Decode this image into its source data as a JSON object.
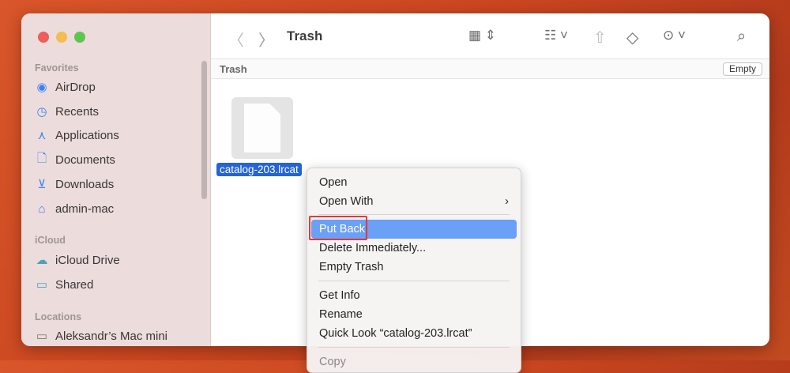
{
  "window": {
    "title": "Trash"
  },
  "sidebar": {
    "sections": [
      {
        "label": "Favorites",
        "items": [
          {
            "label": "AirDrop",
            "icon": "airdrop-icon"
          },
          {
            "label": "Recents",
            "icon": "clock-icon"
          },
          {
            "label": "Applications",
            "icon": "applications-icon"
          },
          {
            "label": "Documents",
            "icon": "document-icon"
          },
          {
            "label": "Downloads",
            "icon": "download-icon"
          },
          {
            "label": "admin-mac",
            "icon": "home-icon"
          }
        ]
      },
      {
        "label": "iCloud",
        "items": [
          {
            "label": "iCloud Drive",
            "icon": "cloud-icon"
          },
          {
            "label": "Shared",
            "icon": "shared-folder-icon"
          }
        ]
      },
      {
        "label": "Locations",
        "items": [
          {
            "label": "Aleksandr’s Mac mini",
            "icon": "computer-icon"
          }
        ]
      }
    ]
  },
  "pathbar": {
    "label": "Trash",
    "empty_button": "Empty"
  },
  "file": {
    "name": "catalog-203.lrcat"
  },
  "context_menu": {
    "items": [
      "Open",
      "Open With",
      "Put Back",
      "Delete Immediately...",
      "Empty Trash",
      "Get Info",
      "Rename",
      "Quick Look “catalog-203.lrcat”",
      "Copy"
    ],
    "selected": "Put Back"
  },
  "colors": {
    "accent": "#2563d8",
    "highlight": "#6aa0f5",
    "annotation": "#e53935"
  }
}
